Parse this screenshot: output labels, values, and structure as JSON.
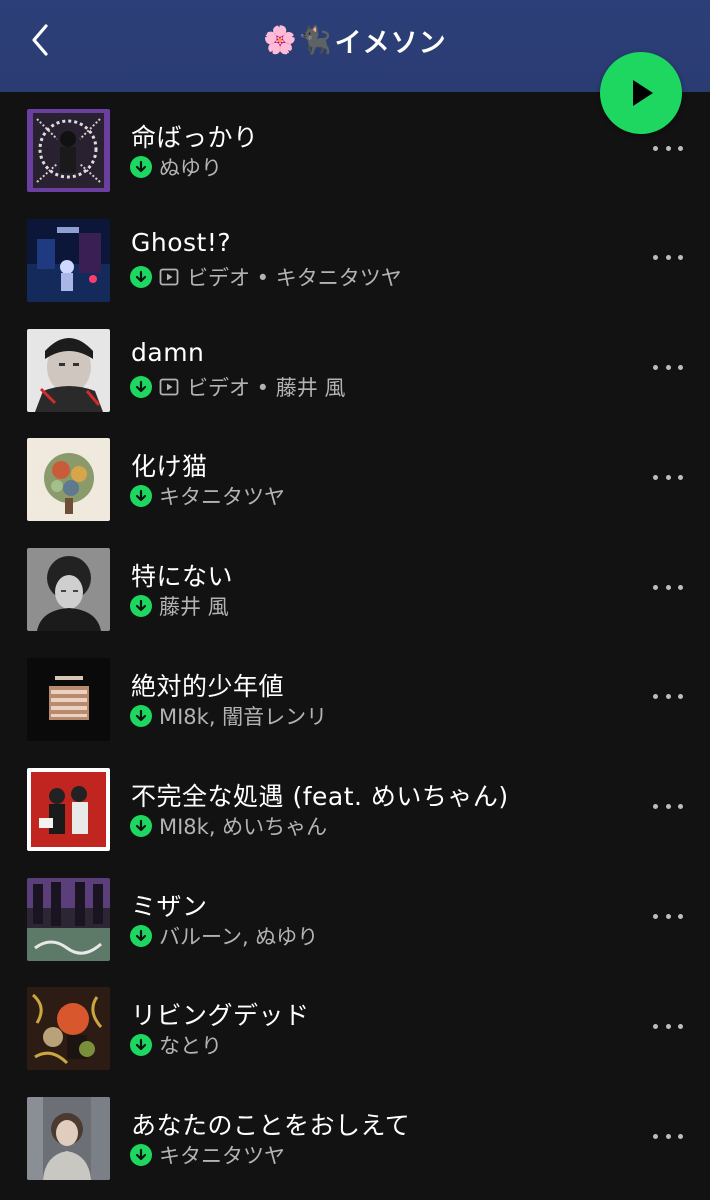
{
  "header": {
    "title_emoji": "🌸🐈‍⬛",
    "title": "イメソン",
    "back_icon": "chevron-left-icon",
    "play_icon": "play-icon",
    "accent": "#1ed760",
    "bar_color": "#2c3f78"
  },
  "tracks": [
    {
      "title": "命ばっかり",
      "video": false,
      "artists": "ぬゆり",
      "art": "art-1"
    },
    {
      "title": "Ghost!?",
      "video": true,
      "artists": "ビデオ • キタニタツヤ",
      "art": "art-2"
    },
    {
      "title": "damn",
      "video": true,
      "artists": "ビデオ • 藤井 風",
      "art": "art-3"
    },
    {
      "title": "化け猫",
      "video": false,
      "artists": "キタニタツヤ",
      "art": "art-4"
    },
    {
      "title": "特にない",
      "video": false,
      "artists": "藤井 風",
      "art": "art-5"
    },
    {
      "title": "絶対的少年値",
      "video": false,
      "artists": "MI8k, 闇音レンリ",
      "art": "art-6"
    },
    {
      "title": "不完全な処遇 (feat. めいちゃん)",
      "video": false,
      "artists": "MI8k, めいちゃん",
      "art": "art-7"
    },
    {
      "title": "ミザン",
      "video": false,
      "artists": "バルーン, ぬゆり",
      "art": "art-8"
    },
    {
      "title": "リビングデッド",
      "video": false,
      "artists": "なとり",
      "art": "art-9"
    },
    {
      "title": "あなたのことをおしえて",
      "video": false,
      "artists": "キタニタツヤ",
      "art": "art-10"
    }
  ]
}
